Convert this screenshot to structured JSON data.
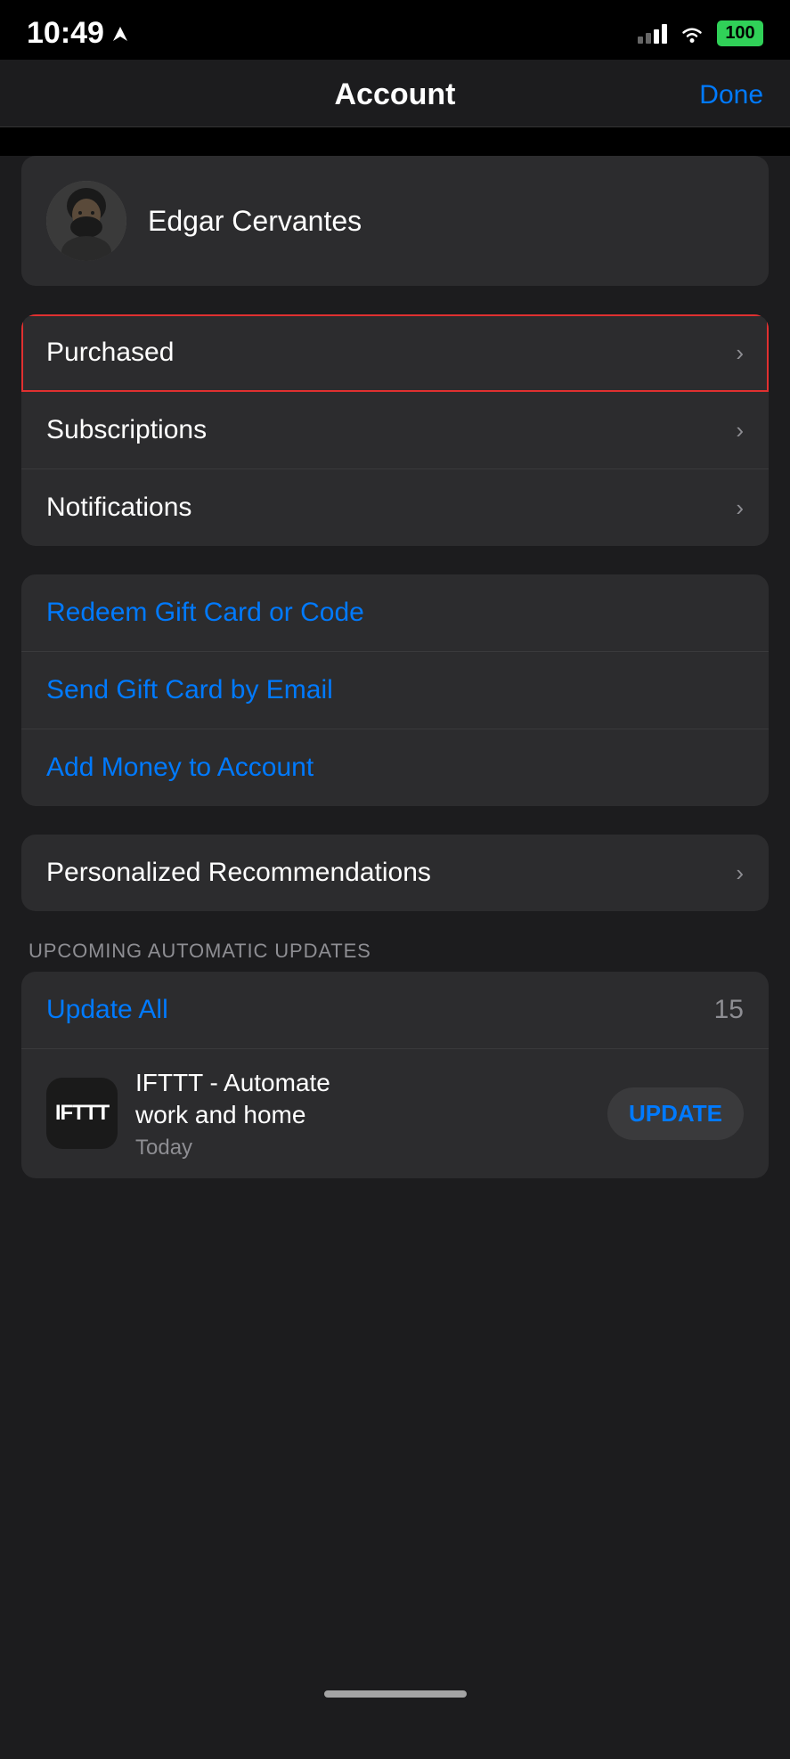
{
  "statusBar": {
    "time": "10:49",
    "battery": "100",
    "batteryIcon": "battery-full-icon"
  },
  "header": {
    "title": "Account",
    "doneLabel": "Done"
  },
  "user": {
    "name": "Edgar Cervantes",
    "avatarAlt": "user-avatar"
  },
  "menuItems": [
    {
      "label": "Purchased",
      "chevron": "›",
      "highlighted": true
    },
    {
      "label": "Subscriptions",
      "chevron": "›",
      "highlighted": false
    },
    {
      "label": "Notifications",
      "chevron": "›",
      "highlighted": false
    }
  ],
  "giftCardItems": [
    {
      "label": "Redeem Gift Card or Code"
    },
    {
      "label": "Send Gift Card by Email"
    },
    {
      "label": "Add Money to Account"
    }
  ],
  "preferences": {
    "label": "Personalized Recommendations",
    "chevron": "›"
  },
  "updatesSection": {
    "header": "UPCOMING AUTOMATIC UPDATES",
    "updateAllLabel": "Update All",
    "updateCount": "15",
    "apps": [
      {
        "iconText": "IFTTT",
        "name": "IFTTT - Automate work and home",
        "date": "Today",
        "updateLabel": "UPDATE"
      }
    ]
  }
}
